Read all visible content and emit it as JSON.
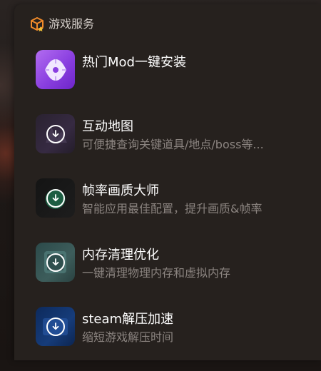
{
  "header": {
    "title": "游戏服务",
    "icon": "box-icon"
  },
  "items": [
    {
      "title": "热门Mod一键安装",
      "description": "",
      "icon": "mod-icon",
      "accent": "#9a4ff0"
    },
    {
      "title": "互动地图",
      "description": "可便捷查询关键道具/地点/boss等...",
      "icon": "map-icon",
      "accent": "#32283d"
    },
    {
      "title": "帧率画质大师",
      "description": "智能应用最佳配置，提升画质&帧率",
      "icon": "fps-icon",
      "accent": "#1a1a1a"
    },
    {
      "title": "内存清理优化",
      "description": "一键清理物理内存和虚拟内存",
      "icon": "memory-icon",
      "accent": "#3a5857"
    },
    {
      "title": "steam解压加速",
      "description": "缩短游戏解压时间",
      "icon": "steam-icon",
      "accent": "#143674"
    }
  ]
}
